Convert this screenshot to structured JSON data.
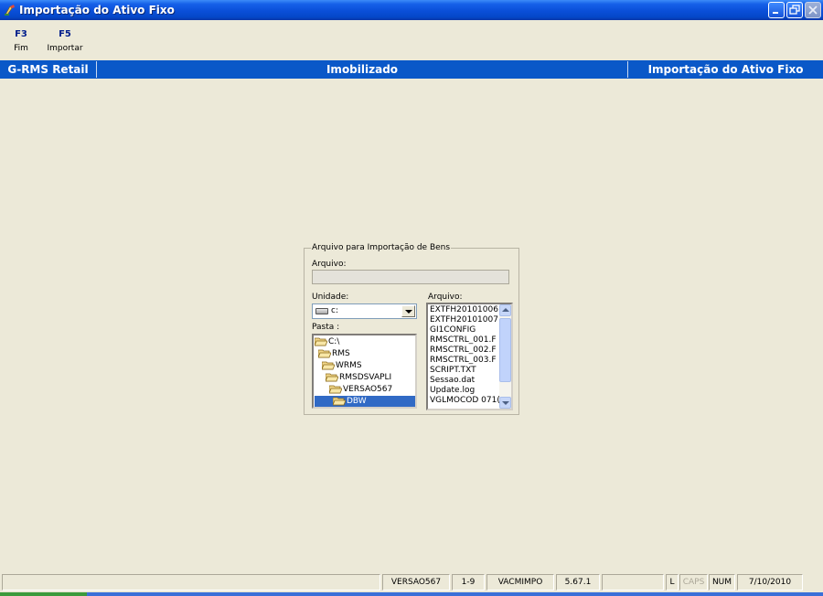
{
  "window": {
    "title": "Importação do Ativo Fixo"
  },
  "toolbar": [
    {
      "key": "F3",
      "label": "Fim"
    },
    {
      "key": "F5",
      "label": "Importar"
    }
  ],
  "infobar": {
    "system": "G-RMS Retail",
    "module": "Imobilizado",
    "screen": "Importação do Ativo Fixo"
  },
  "group": {
    "legend": "Arquivo para Importação de Bens",
    "arquivo_label": "Arquivo:",
    "arquivo_value": "",
    "unidade_label": "Unidade:",
    "unidade_value": "c:",
    "pasta_label": "Pasta :",
    "arquivo_list_label": "Arquivo:",
    "folders": [
      "C:\\",
      "RMS",
      "WRMS",
      "RMSDSVAPLI",
      "VERSAO567",
      "DBW"
    ],
    "selected_folder": "DBW",
    "files": [
      "EXTFH20101006",
      "EXTFH20101007",
      "GI1CONFIG",
      "RMSCTRL_001.F",
      "RMSCTRL_002.F",
      "RMSCTRL_003.F",
      "SCRIPT.TXT",
      "Sessao.dat",
      "Update.log",
      "VGLMOCOD 071("
    ]
  },
  "status": {
    "version": "VERSAO567",
    "range": "1-9",
    "program": "VACMIMPO",
    "build": "5.67.1",
    "ind_l": "L",
    "ind_caps": "CAPS",
    "ind_num": "NUM",
    "date": "7/10/2010"
  },
  "colors": {
    "titlebar": "#0A4FD8",
    "infobar": "#0A58C8",
    "selection": "#316AC5",
    "toolbar_key": "#001E8C"
  }
}
